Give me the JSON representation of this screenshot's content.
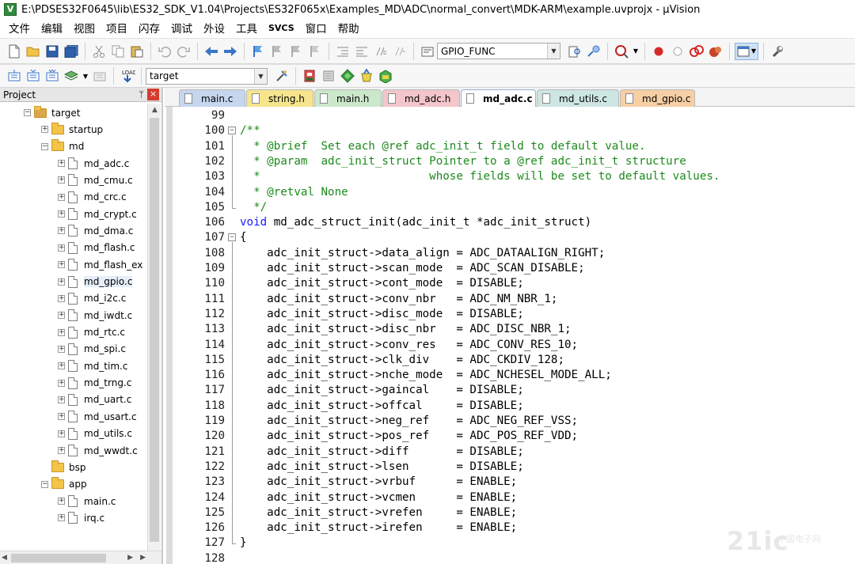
{
  "window": {
    "title": "E:\\PDSES32F0645\\lib\\ES32_SDK_V1.04\\Projects\\ES32F065x\\Examples_MD\\ADC\\normal_convert\\MDK-ARM\\example.uvprojx - µVision"
  },
  "menu": [
    "文件",
    "编辑",
    "视图",
    "项目",
    "闪存",
    "调试",
    "外设",
    "工具",
    "SVCS",
    "窗口",
    "帮助"
  ],
  "toolbar1": {
    "find_combo": "GPIO_FUNC"
  },
  "toolbar2": {
    "target_combo": "target"
  },
  "project": {
    "title": "Project",
    "pin_glyph": "ᛘ",
    "close_glyph": "×",
    "items": [
      {
        "label": "target",
        "kind": "target",
        "indent": 0,
        "exp": "−"
      },
      {
        "label": "startup",
        "kind": "folder",
        "indent": 1,
        "exp": "+"
      },
      {
        "label": "md",
        "kind": "folder",
        "indent": 1,
        "exp": "−"
      },
      {
        "label": "md_adc.c",
        "kind": "file",
        "indent": 2,
        "exp": "+"
      },
      {
        "label": "md_cmu.c",
        "kind": "file",
        "indent": 2,
        "exp": "+"
      },
      {
        "label": "md_crc.c",
        "kind": "file",
        "indent": 2,
        "exp": "+"
      },
      {
        "label": "md_crypt.c",
        "kind": "file",
        "indent": 2,
        "exp": "+"
      },
      {
        "label": "md_dma.c",
        "kind": "file",
        "indent": 2,
        "exp": "+"
      },
      {
        "label": "md_flash.c",
        "kind": "file",
        "indent": 2,
        "exp": "+"
      },
      {
        "label": "md_flash_ex",
        "kind": "file",
        "indent": 2,
        "exp": "+"
      },
      {
        "label": "md_gpio.c",
        "kind": "file",
        "indent": 2,
        "exp": "+",
        "selected": true
      },
      {
        "label": "md_i2c.c",
        "kind": "file",
        "indent": 2,
        "exp": "+"
      },
      {
        "label": "md_iwdt.c",
        "kind": "file",
        "indent": 2,
        "exp": "+"
      },
      {
        "label": "md_rtc.c",
        "kind": "file",
        "indent": 2,
        "exp": "+"
      },
      {
        "label": "md_spi.c",
        "kind": "file",
        "indent": 2,
        "exp": "+"
      },
      {
        "label": "md_tim.c",
        "kind": "file",
        "indent": 2,
        "exp": "+"
      },
      {
        "label": "md_trng.c",
        "kind": "file",
        "indent": 2,
        "exp": "+"
      },
      {
        "label": "md_uart.c",
        "kind": "file",
        "indent": 2,
        "exp": "+"
      },
      {
        "label": "md_usart.c",
        "kind": "file",
        "indent": 2,
        "exp": "+"
      },
      {
        "label": "md_utils.c",
        "kind": "file",
        "indent": 2,
        "exp": "+"
      },
      {
        "label": "md_wwdt.c",
        "kind": "file",
        "indent": 2,
        "exp": "+"
      },
      {
        "label": "bsp",
        "kind": "folder",
        "indent": 1,
        "exp": ""
      },
      {
        "label": "app",
        "kind": "folder",
        "indent": 1,
        "exp": "−"
      },
      {
        "label": "main.c",
        "kind": "file",
        "indent": 2,
        "exp": "+"
      },
      {
        "label": "irq.c",
        "kind": "file",
        "indent": 2,
        "exp": "+"
      }
    ]
  },
  "tabs": [
    {
      "label": "main.c",
      "color": "#c6d6ee",
      "active": false
    },
    {
      "label": "string.h",
      "color": "#f6e58c",
      "active": false
    },
    {
      "label": "main.h",
      "color": "#cbe8cb",
      "active": false
    },
    {
      "label": "md_adc.h",
      "color": "#f3c6cb",
      "active": false
    },
    {
      "label": "md_adc.c",
      "color": "#ffffff",
      "active": true
    },
    {
      "label": "md_utils.c",
      "color": "#cde6e2",
      "active": false
    },
    {
      "label": "md_gpio.c",
      "color": "#f7cfa5",
      "active": false
    }
  ],
  "code": [
    {
      "n": "99",
      "parts": [
        {
          "c": "txt",
          "t": ""
        }
      ]
    },
    {
      "n": "100",
      "fold": "−",
      "parts": [
        {
          "c": "cm",
          "t": "/**"
        }
      ]
    },
    {
      "n": "101",
      "parts": [
        {
          "c": "cm",
          "t": "  * @brief  Set each @ref adc_init_t field to default value."
        }
      ]
    },
    {
      "n": "102",
      "parts": [
        {
          "c": "cm",
          "t": "  * @param  adc_init_struct Pointer to a @ref adc_init_t structure"
        }
      ]
    },
    {
      "n": "103",
      "parts": [
        {
          "c": "cm",
          "t": "  *                         whose fields will be set to default values."
        }
      ]
    },
    {
      "n": "104",
      "parts": [
        {
          "c": "cm",
          "t": "  * @retval None"
        }
      ]
    },
    {
      "n": "105",
      "parts": [
        {
          "c": "cm",
          "t": "  */"
        }
      ]
    },
    {
      "n": "106",
      "parts": [
        {
          "c": "kw",
          "t": "void"
        },
        {
          "c": "txt",
          "t": " md_adc_struct_init(adc_init_t *adc_init_struct)"
        }
      ]
    },
    {
      "n": "107",
      "fold": "−",
      "parts": [
        {
          "c": "txt",
          "t": "{"
        }
      ]
    },
    {
      "n": "108",
      "parts": [
        {
          "c": "txt",
          "t": "    adc_init_struct->data_align = ADC_DATAALIGN_RIGHT;"
        }
      ]
    },
    {
      "n": "109",
      "parts": [
        {
          "c": "txt",
          "t": "    adc_init_struct->scan_mode  = ADC_SCAN_DISABLE;"
        }
      ]
    },
    {
      "n": "110",
      "parts": [
        {
          "c": "txt",
          "t": "    adc_init_struct->cont_mode  = DISABLE;"
        }
      ]
    },
    {
      "n": "111",
      "parts": [
        {
          "c": "txt",
          "t": "    adc_init_struct->conv_nbr   = ADC_NM_NBR_1;"
        }
      ]
    },
    {
      "n": "112",
      "parts": [
        {
          "c": "txt",
          "t": "    adc_init_struct->disc_mode  = DISABLE;"
        }
      ]
    },
    {
      "n": "113",
      "parts": [
        {
          "c": "txt",
          "t": "    adc_init_struct->disc_nbr   = ADC_DISC_NBR_1;"
        }
      ]
    },
    {
      "n": "114",
      "parts": [
        {
          "c": "txt",
          "t": "    adc_init_struct->conv_res   = ADC_CONV_RES_10;"
        }
      ]
    },
    {
      "n": "115",
      "parts": [
        {
          "c": "txt",
          "t": "    adc_init_struct->clk_div    = ADC_CKDIV_128;"
        }
      ]
    },
    {
      "n": "116",
      "parts": [
        {
          "c": "txt",
          "t": "    adc_init_struct->nche_mode  = ADC_NCHESEL_MODE_ALL;"
        }
      ]
    },
    {
      "n": "117",
      "parts": [
        {
          "c": "txt",
          "t": "    adc_init_struct->gaincal    = DISABLE;"
        }
      ]
    },
    {
      "n": "118",
      "parts": [
        {
          "c": "txt",
          "t": "    adc_init_struct->offcal     = DISABLE;"
        }
      ]
    },
    {
      "n": "119",
      "parts": [
        {
          "c": "txt",
          "t": "    adc_init_struct->neg_ref    = ADC_NEG_REF_VSS;"
        }
      ]
    },
    {
      "n": "120",
      "parts": [
        {
          "c": "txt",
          "t": "    adc_init_struct->pos_ref    = ADC_POS_REF_VDD;"
        }
      ]
    },
    {
      "n": "121",
      "parts": [
        {
          "c": "txt",
          "t": "    adc_init_struct->diff       = DISABLE;"
        }
      ]
    },
    {
      "n": "122",
      "parts": [
        {
          "c": "txt",
          "t": "    adc_init_struct->lsen       = DISABLE;"
        }
      ]
    },
    {
      "n": "123",
      "parts": [
        {
          "c": "txt",
          "t": "    adc_init_struct->vrbuf      = ENABLE;"
        }
      ]
    },
    {
      "n": "124",
      "parts": [
        {
          "c": "txt",
          "t": "    adc_init_struct->vcmen      = ENABLE;"
        }
      ]
    },
    {
      "n": "125",
      "parts": [
        {
          "c": "txt",
          "t": "    adc_init_struct->vrefen     = ENABLE;"
        }
      ]
    },
    {
      "n": "126",
      "parts": [
        {
          "c": "txt",
          "t": "    adc_init_struct->irefen     = ENABLE;"
        }
      ]
    },
    {
      "n": "127",
      "parts": [
        {
          "c": "txt",
          "t": "}"
        }
      ]
    },
    {
      "n": "128",
      "parts": [
        {
          "c": "txt",
          "t": ""
        }
      ]
    }
  ],
  "watermark": {
    "big": "21ic",
    "small": "中国电子网"
  }
}
